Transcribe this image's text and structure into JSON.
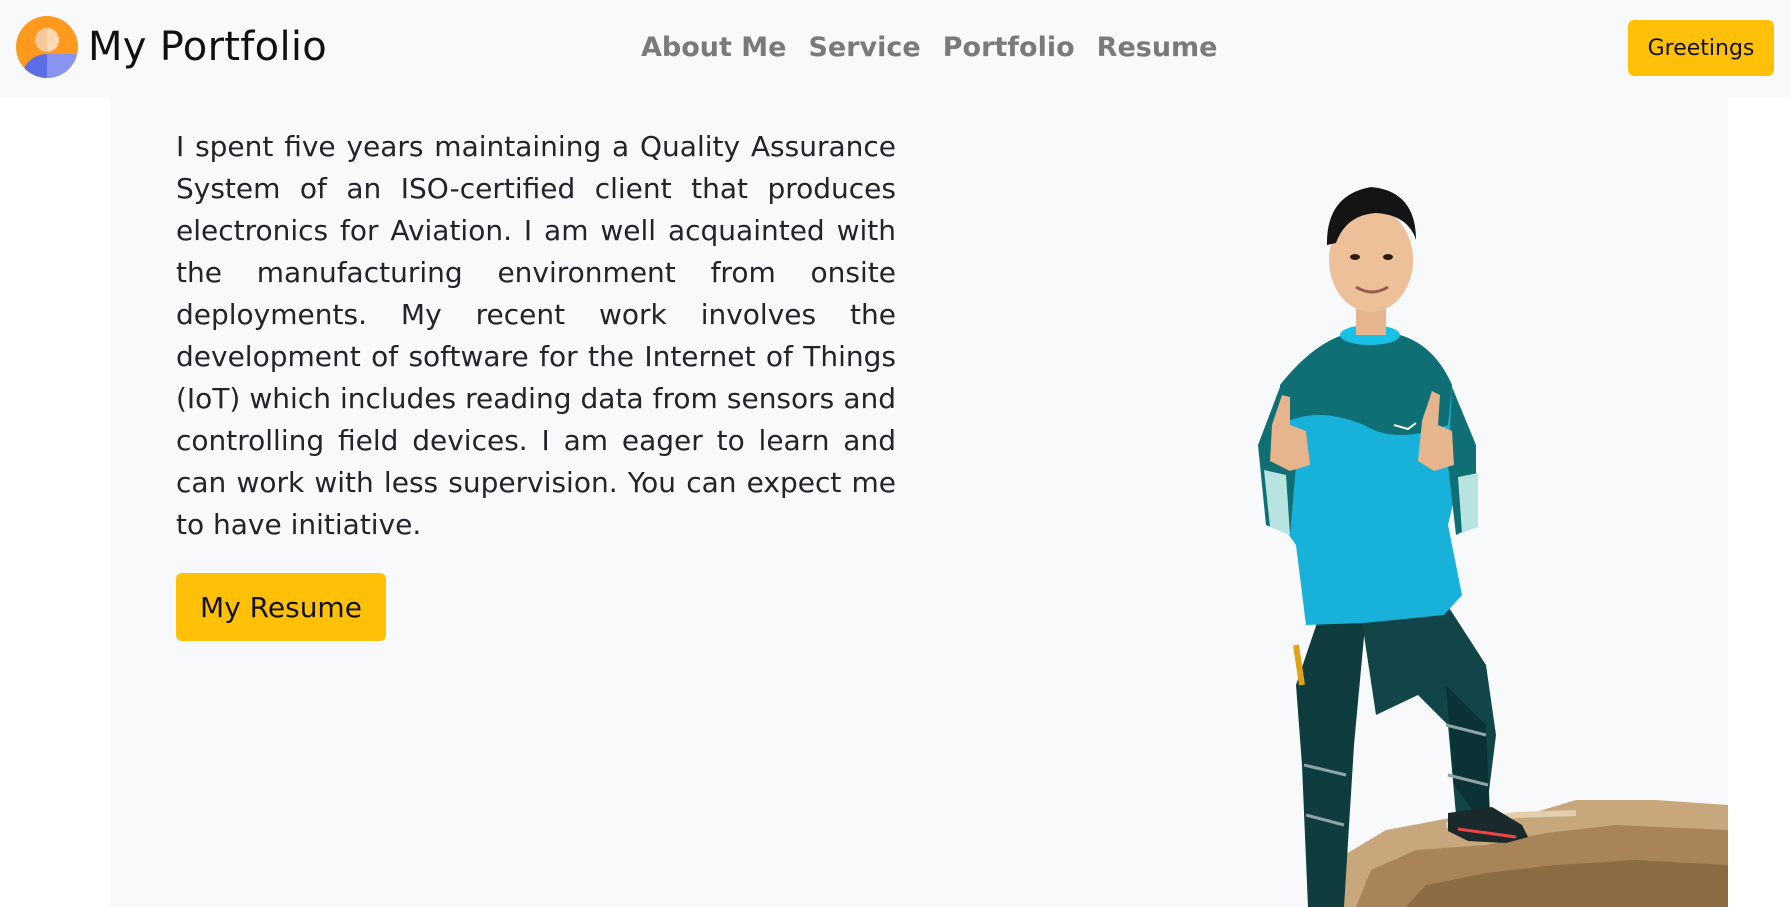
{
  "navbar": {
    "brand": "My Portfolio",
    "links": [
      "About Me",
      "Service",
      "Portfolio",
      "Resume"
    ],
    "greetings_label": "Greetings"
  },
  "hero": {
    "bio": "I spent five years maintaining a Quality Assurance System of an ISO-certified client that produces electronics for Aviation. I am well acquainted with the manufacturing environment from onsite deployments. My recent work involves the development of software for the Internet of Things (IoT) which includes reading data from sensors and controlling field devices. I am eager to learn and can work with less supervision. You can expect me to have initiative.",
    "resume_button": "My Resume"
  },
  "colors": {
    "accent": "#ffc107",
    "navbar_bg": "#f8f9fa",
    "nav_link": "#7a7a7a",
    "shirt": "#17b1d9",
    "pants": "#0e3c3f"
  },
  "icons": {
    "logo": "avatar-logo-icon"
  }
}
